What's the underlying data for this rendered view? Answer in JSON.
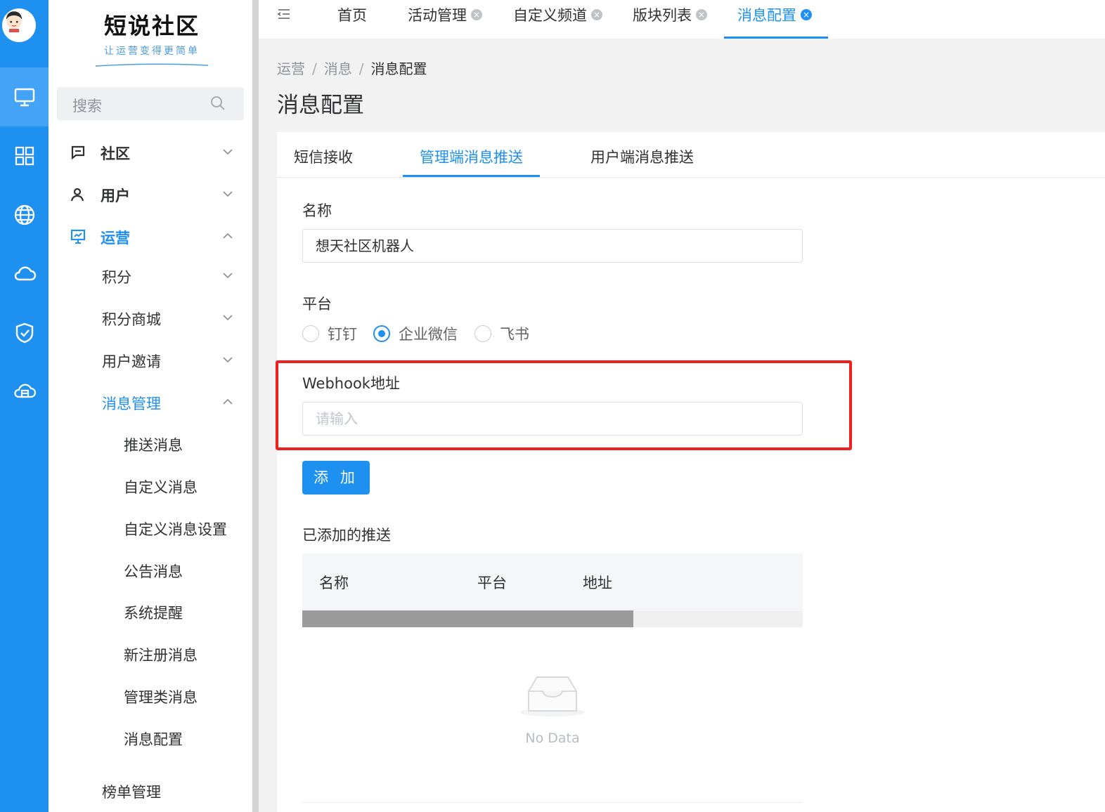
{
  "brand": {
    "title": "短说社区",
    "slogan": "让运营变得更简单"
  },
  "rail": {
    "icons": [
      "monitor-icon",
      "grid-icon",
      "globe-icon",
      "cloud-icon",
      "shield-check-icon",
      "cloud-server-icon"
    ],
    "active_index": 0
  },
  "search": {
    "placeholder": "搜索"
  },
  "menu": {
    "community": "社区",
    "users": "用户",
    "operations": "运营",
    "points": "积分",
    "points_mall": "积分商城",
    "user_invite": "用户邀请",
    "message_mgmt": "消息管理",
    "push_message": "推送消息",
    "custom_message": "自定义消息",
    "custom_message_settings": "自定义消息设置",
    "announcement": "公告消息",
    "system_reminder": "系统提醒",
    "new_register": "新注册消息",
    "admin_message": "管理类消息",
    "message_config": "消息配置",
    "ranking_mgmt": "榜单管理"
  },
  "tabs": {
    "home": "首页",
    "activity": "活动管理",
    "custom_channel": "自定义频道",
    "section_list": "版块列表",
    "message_config": "消息配置"
  },
  "breadcrumb": {
    "level1": "运营",
    "level2": "消息",
    "current": "消息配置",
    "separator": "/"
  },
  "page_title": "消息配置",
  "panel_tabs": {
    "sms": "短信接收",
    "admin_push": "管理端消息推送",
    "user_push": "用户端消息推送"
  },
  "form": {
    "name_label": "名称",
    "name_value": "想天社区机器人",
    "platform_label": "平台",
    "platform_options": [
      "钉钉",
      "企业微信",
      "飞书"
    ],
    "platform_selected": "企业微信",
    "webhook_label": "Webhook地址",
    "webhook_placeholder": "请输入",
    "add_button": "添 加"
  },
  "added": {
    "title": "已添加的推送",
    "columns": [
      "名称",
      "平台",
      "地址"
    ],
    "empty_text": "No Data"
  },
  "colors": {
    "accent": "#1e90f0",
    "highlight_box": "#f0201c"
  }
}
